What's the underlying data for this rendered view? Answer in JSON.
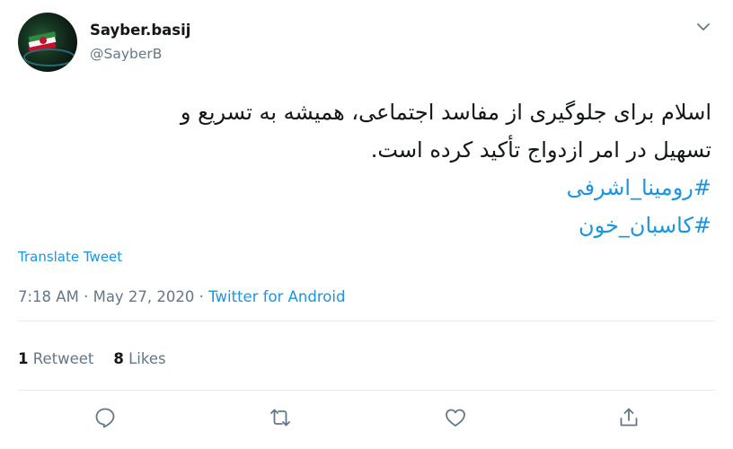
{
  "user": {
    "display_name": "Sayber.basij",
    "handle": "@SayberB"
  },
  "tweet": {
    "line1": "اسلام برای جلوگیری از مفاسد اجتماعی، همیشه به تسریع و",
    "line2": "تسهیل در امر ازدواج تأکید کرده است.",
    "hashtag1": "#رومینا_اشرفی",
    "hashtag2": "#کاسبان_خون"
  },
  "translate_label": "Translate Tweet",
  "meta": {
    "time": "7:18 AM",
    "sep1": " · ",
    "date": "May 27, 2020",
    "sep2": " · ",
    "source": "Twitter for Android"
  },
  "stats": {
    "retweets_count": "1",
    "retweets_label": "Retweet",
    "likes_count": "8",
    "likes_label": "Likes"
  },
  "actions": [
    "reply-icon",
    "retweet-icon",
    "like-icon",
    "share-icon"
  ],
  "colors": {
    "link": "#1b95e0",
    "secondary_text": "#657786",
    "primary_text": "#14171a",
    "divider": "#e6ecf0"
  }
}
